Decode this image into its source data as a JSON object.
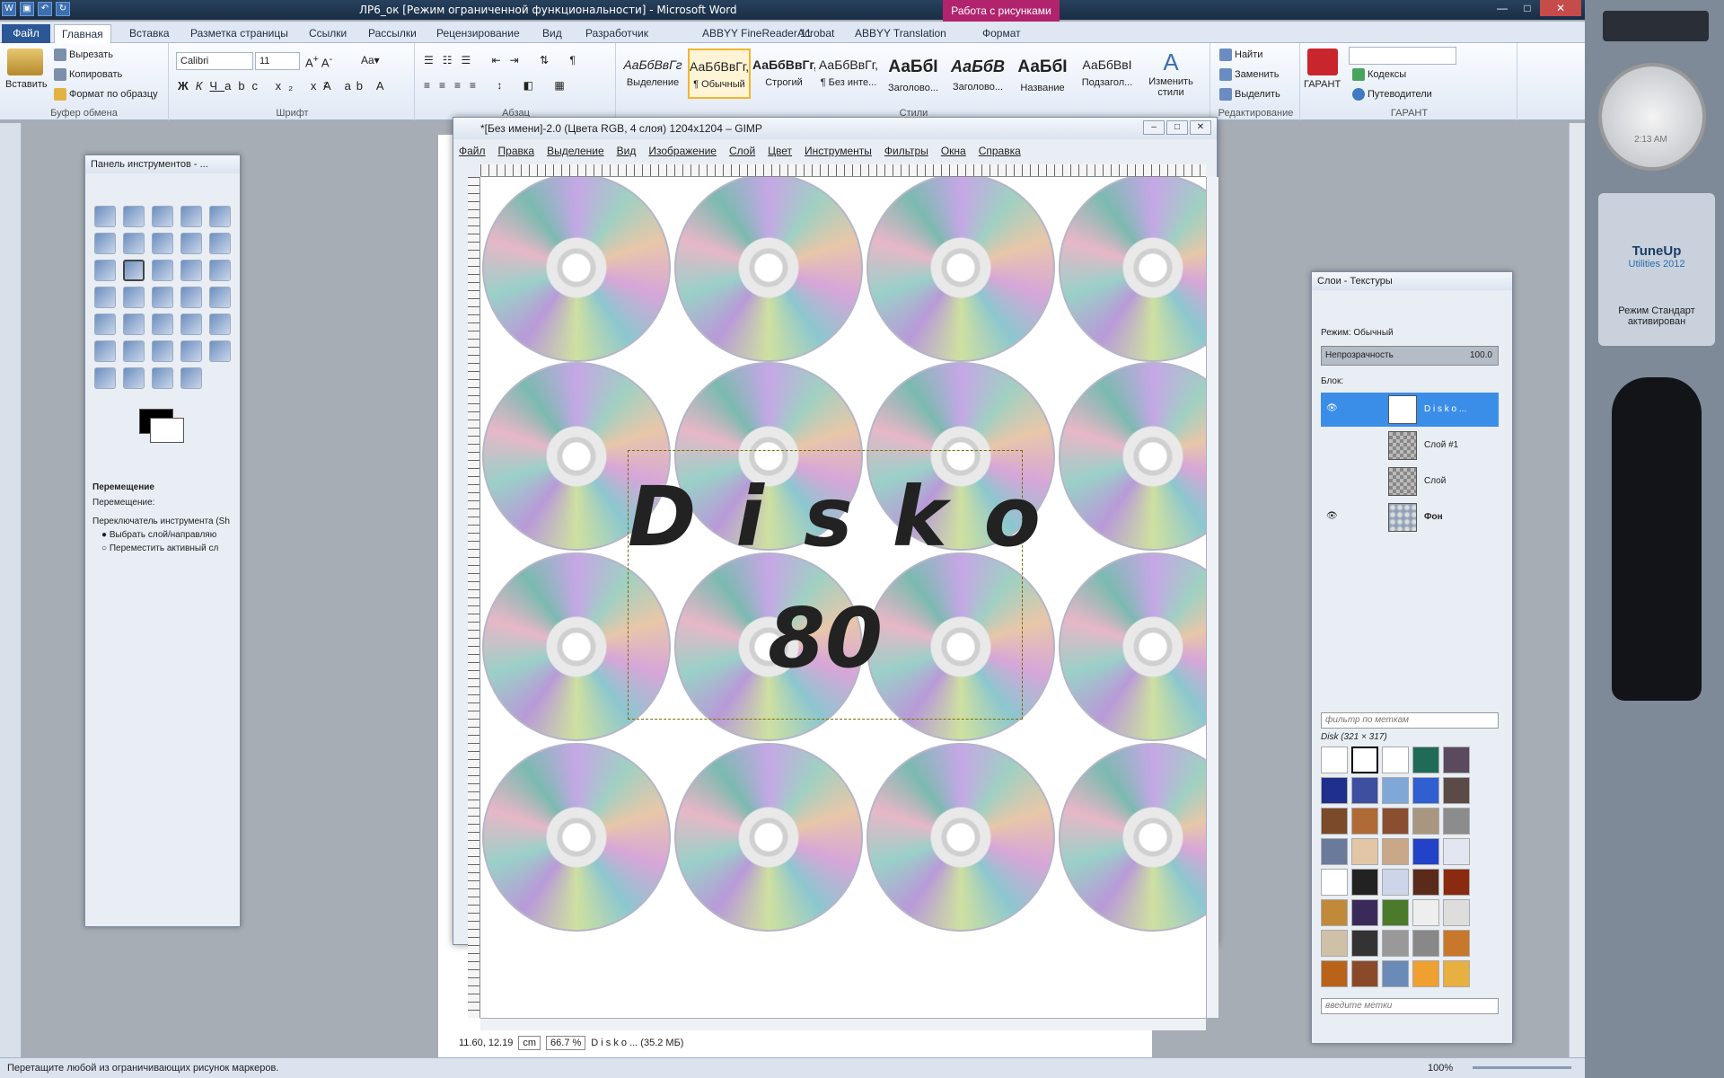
{
  "word": {
    "title": "ЛР6_ок [Режим ограниченной функциональности] - Microsoft Word",
    "context_tab_group": "Работа с рисунками",
    "tabs": [
      "Файл",
      "Главная",
      "Вставка",
      "Разметка страницы",
      "Ссылки",
      "Рассылки",
      "Рецензирование",
      "Вид",
      "Разработчик",
      "ABBYY FineReader 11",
      "Acrobat",
      "ABBYY Translation",
      "Формат"
    ],
    "clipboard": {
      "paste": "Вставить",
      "cut": "Вырезать",
      "copy": "Копировать",
      "format_painter": "Формат по образцу",
      "group": "Буфер обмена"
    },
    "font": {
      "name": "Calibri",
      "size": "11",
      "group": "Шрифт"
    },
    "paragraph_group": "Абзац",
    "styles": [
      {
        "sample": "АаБбВвГг",
        "name": "Выделение"
      },
      {
        "sample": "АаБбВвГг,",
        "name": "¶ Обычный"
      },
      {
        "sample": "АаБбВвГг,",
        "name": "Строгий"
      },
      {
        "sample": "АаБбВвГг,",
        "name": "¶ Без инте..."
      },
      {
        "sample": "АаБбI",
        "name": "Заголово..."
      },
      {
        "sample": "АаБбВ",
        "name": "Заголово..."
      },
      {
        "sample": "АаБбI",
        "name": "Название"
      },
      {
        "sample": "АаБбВвI",
        "name": "Подзагол..."
      }
    ],
    "styles_group": "Стили",
    "change_styles": "Изменить стили",
    "editing": {
      "find": "Найти",
      "replace": "Заменить",
      "select": "Выделить",
      "group": "Редактирование"
    },
    "garant": {
      "label": "ГАРАНТ",
      "codes": "Кодексы",
      "guides": "Путеводители",
      "group": "ГАРАНТ"
    },
    "status_text": "Перетащите любой из ограничивающих рисунок маркеров.",
    "zoom": "100%"
  },
  "gimp": {
    "title": "*[Без имени]-2.0 (Цвета RGB, 4 слоя) 1204x1204 – GIMP",
    "menu": [
      "Файл",
      "Правка",
      "Выделение",
      "Вид",
      "Изображение",
      "Слой",
      "Цвет",
      "Инструменты",
      "Фильтры",
      "Окна",
      "Справка"
    ],
    "text_line1": "Disko",
    "text_line2": "80",
    "coords": "11.60, 12.19",
    "unit": "cm",
    "zoom": "66.7 %",
    "layer_info": "D i s k o ... (35.2 МБ)"
  },
  "tools": {
    "title": "Панель инструментов - ...",
    "tool_name": "Перемещение",
    "move_label": "Перемещение:",
    "switch_label": "Переключатель инструмента  (Sh",
    "opt1": "Выбрать слой/направляю",
    "opt2": "Переместить активный сл"
  },
  "layers": {
    "title": "Слои - Текстуры",
    "mode_label": "Режим: Обычный",
    "opacity_label": "Непрозрачность",
    "opacity_value": "100.0",
    "lock_label": "Блок:",
    "items": [
      "D i s k o ...",
      "Слой #1",
      "Слой",
      "Фон"
    ],
    "filter_placeholder": "фильтр по меткам",
    "pattern_name": "Disk (321 × 317)",
    "tags_placeholder": "введите метки"
  },
  "gadgets": {
    "clock_time": "2:13 AM",
    "tuneup_title": "TuneUp",
    "tuneup_sub": "Utilities 2012",
    "tuneup_mode": "Режим Стандарт активирован"
  }
}
